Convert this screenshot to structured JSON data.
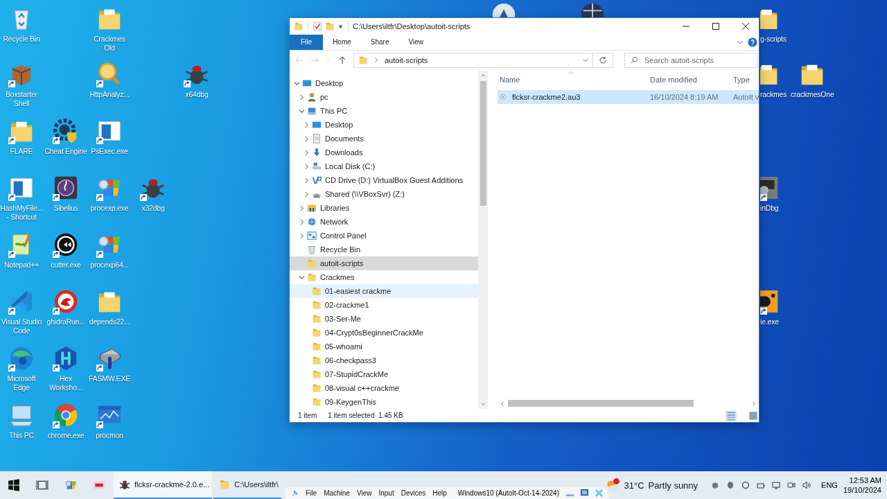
{
  "desktop": {
    "icons": [
      {
        "label": "Recycle Bin",
        "kind": "recycle",
        "shortcut": false
      },
      {
        "label": "Crackmes Old",
        "kind": "folder",
        "shortcut": false
      },
      {
        "label": "Boxstarter Shell",
        "kind": "box",
        "shortcut": true
      },
      {
        "label": "HttpAnalyz...",
        "kind": "magnifier",
        "shortcut": true
      },
      {
        "label": "x64dbg",
        "kind": "bug",
        "shortcut": true
      },
      {
        "label": "FLARE",
        "kind": "folder",
        "shortcut": true
      },
      {
        "label": "Cheat Engine",
        "kind": "gear",
        "shortcut": true
      },
      {
        "label": "PsExec.exe",
        "kind": "window",
        "shortcut": true
      },
      {
        "label": "HashMyFile... - Shortcut",
        "kind": "window",
        "shortcut": true
      },
      {
        "label": "Sibelius",
        "kind": "clef",
        "shortcut": true
      },
      {
        "label": "procexp.exe",
        "kind": "winlogo",
        "shortcut": true
      },
      {
        "label": "x32dbg",
        "kind": "bug",
        "shortcut": true
      },
      {
        "label": "Notepad++",
        "kind": "notepad",
        "shortcut": true
      },
      {
        "label": "cutter.exe",
        "kind": "cutter",
        "shortcut": true
      },
      {
        "label": "procexp64...",
        "kind": "winlogo",
        "shortcut": true
      },
      {
        "label": "Visual Studio Code",
        "kind": "vscode",
        "shortcut": true
      },
      {
        "label": "ghidraRun...",
        "kind": "dragon",
        "shortcut": true
      },
      {
        "label": "depends22...",
        "kind": "folder",
        "shortcut": false
      },
      {
        "label": "Microsoft Edge",
        "kind": "edge",
        "shortcut": true
      },
      {
        "label": "Hex Worksho...",
        "kind": "hex",
        "shortcut": true
      },
      {
        "label": "FASMW.EXE",
        "kind": "fasm",
        "shortcut": true
      },
      {
        "label": "This PC",
        "kind": "pc",
        "shortcut": false
      },
      {
        "label": "chrome.exe",
        "kind": "chrome",
        "shortcut": true
      },
      {
        "label": "procmon",
        "kind": "procmon",
        "shortcut": true
      },
      {
        "kind": "badge",
        "shortcut": false
      },
      {
        "kind": "globe",
        "shortcut": false
      },
      {
        "label": "g-scripts",
        "kind": "folder",
        "shortcut": false
      },
      {
        "label": "rackmes",
        "kind": "folder",
        "shortcut": false
      },
      {
        "label": "crackmesOne",
        "kind": "folder",
        "shortcut": false
      },
      {
        "label": "inDbg",
        "kind": "windbg",
        "shortcut": true
      },
      {
        "label": "ie.exe",
        "kind": "die",
        "shortcut": true
      }
    ]
  },
  "explorer": {
    "title": "C:\\Users\\iltfr\\Desktop\\autoit-scripts",
    "ribbon_tabs": [
      {
        "label": "File",
        "kind": "file"
      },
      {
        "label": "Home",
        "kind": "tab"
      },
      {
        "label": "Share",
        "kind": "tab"
      },
      {
        "label": "View",
        "kind": "tab"
      }
    ],
    "address": "autoit-scripts",
    "search": {
      "placeholder": "Search autoit-scripts"
    },
    "tree": [
      {
        "label": "Desktop",
        "kind": "desktop",
        "expanded": true,
        "selected": false,
        "hovered": false,
        "children": [
          {
            "label": "pc",
            "kind": "user",
            "expanded": false,
            "selected": false,
            "hovered": false
          },
          {
            "label": "This PC",
            "kind": "pc",
            "expanded": true,
            "selected": false,
            "hovered": false,
            "children": [
              {
                "label": "Desktop",
                "kind": "desktop",
                "expanded": false,
                "selected": false,
                "hovered": false
              },
              {
                "label": "Documents",
                "kind": "documents",
                "expanded": false,
                "selected": false,
                "hovered": false
              },
              {
                "label": "Downloads",
                "kind": "downloads",
                "expanded": false,
                "selected": false,
                "hovered": false
              },
              {
                "label": "Local Disk (C:)",
                "kind": "disk",
                "expanded": false,
                "selected": false,
                "hovered": false
              },
              {
                "label": "CD Drive (D:) VirtualBox Guest Additions",
                "kind": "cd",
                "expanded": false,
                "selected": false,
                "hovered": false
              },
              {
                "label": "Shared (\\\\VBoxSvr) (Z:)",
                "kind": "netdrive",
                "expanded": false,
                "selected": false,
                "hovered": false
              }
            ]
          },
          {
            "label": "Libraries",
            "kind": "libraries",
            "expanded": false,
            "selected": false,
            "hovered": false
          },
          {
            "label": "Network",
            "kind": "network",
            "expanded": false,
            "selected": false,
            "hovered": false
          },
          {
            "label": "Control Panel",
            "kind": "control",
            "expanded": false,
            "selected": false,
            "hovered": false
          },
          {
            "label": "Recycle Bin",
            "kind": "recycle",
            "selected": false,
            "hovered": false
          },
          {
            "label": "autoit-scripts",
            "kind": "folder",
            "selected": true,
            "hovered": false
          },
          {
            "label": "Crackmes",
            "kind": "folder",
            "expanded": true,
            "selected": false,
            "hovered": false,
            "children": [
              {
                "label": "01-easiest crackme",
                "kind": "folder",
                "selected": false,
                "hovered": true
              },
              {
                "label": "02-crackme1",
                "kind": "folder",
                "selected": false,
                "hovered": false
              },
              {
                "label": "03-Ser-Me",
                "kind": "folder",
                "selected": false,
                "hovered": false
              },
              {
                "label": "04-Crypt0sBeginnerCrackMe",
                "kind": "folder",
                "selected": false,
                "hovered": false
              },
              {
                "label": "05-whoami",
                "kind": "folder",
                "selected": false,
                "hovered": false
              },
              {
                "label": "06-checkpass3",
                "kind": "folder",
                "selected": false,
                "hovered": false
              },
              {
                "label": "07-StupidCrackMe",
                "kind": "folder",
                "selected": false,
                "hovered": false
              },
              {
                "label": "08-visual c++crackme",
                "kind": "folder",
                "selected": false,
                "hovered": false
              },
              {
                "label": "09-KeygenThis",
                "kind": "folder",
                "selected": false,
                "hovered": false
              }
            ]
          }
        ]
      }
    ],
    "columns": [
      "Name",
      "Date modified",
      "Type"
    ],
    "files": [
      {
        "name": "flcksr-crackme2.au3",
        "date": "16/10/2024 8:19 AM",
        "type": "AutoIt v",
        "selected": true
      }
    ],
    "status": {
      "count": "1 item",
      "selection": "1 item selected  1.45 KB"
    }
  },
  "taskbar": {
    "tasks": [
      {
        "label": "flcksr-crackme-2.0.e...",
        "kind": "bug",
        "active": true
      },
      {
        "label": "C:\\Users\\iltfr\\",
        "kind": "folder",
        "active": false
      }
    ],
    "vbox": {
      "menu": [
        "File",
        "Machine",
        "View",
        "Input",
        "Devices",
        "Help"
      ],
      "title": "Windows10 (AutoIt-Oct-14-2024)"
    },
    "weather": {
      "temp": "31°C",
      "text": "Partly sunny"
    },
    "language": "ENG",
    "time": "12:53 AM",
    "date": "19/10/2024"
  }
}
